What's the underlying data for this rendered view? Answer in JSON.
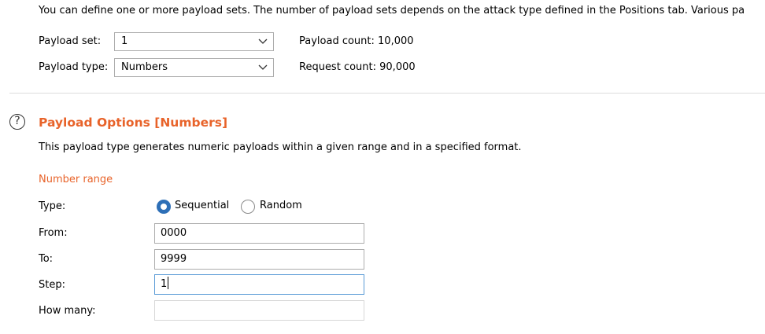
{
  "intro_text": "You can define one or more payload sets. The number of payload sets depends on the attack type defined in the Positions tab. Various pa",
  "payload_set": {
    "label": "Payload set:",
    "value": "1",
    "count_label": "Payload count:",
    "count_value": "10,000"
  },
  "payload_type": {
    "label": "Payload type:",
    "value": "Numbers",
    "count_label": "Request count:",
    "count_value": "90,000"
  },
  "options": {
    "title": "Payload Options [Numbers]",
    "description": "This payload type generates numeric payloads within a given range and in a specified format.",
    "number_range_heading": "Number range",
    "type_label": "Type:",
    "type_options": [
      {
        "label": "Sequential",
        "selected": true
      },
      {
        "label": "Random",
        "selected": false
      }
    ],
    "from_label": "From:",
    "from_value": "0000",
    "to_label": "To:",
    "to_value": "9999",
    "step_label": "Step:",
    "step_value": "1",
    "how_many_label": "How many:",
    "how_many_value": ""
  },
  "colors": {
    "accent": "#e8632a",
    "radio_selected": "#2d6fb7",
    "focus_border": "#5a9bd6"
  },
  "icons": {
    "help": "question-circle-icon",
    "dropdown": "chevron-down-icon"
  }
}
